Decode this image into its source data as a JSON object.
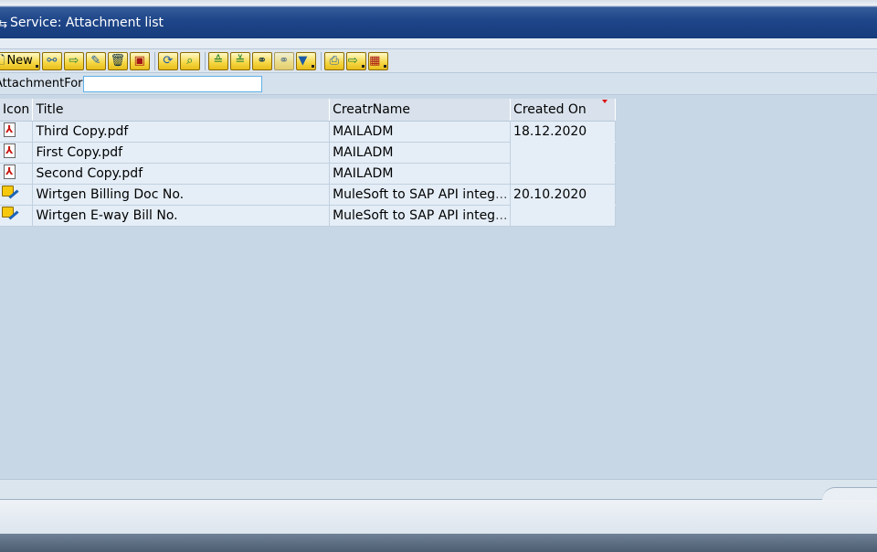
{
  "window": {
    "title": "Service: Attachment list",
    "title_icon": "service-icon"
  },
  "toolbar": {
    "new_label": "New",
    "buttons": [
      {
        "name": "new-button",
        "icon": "new-document-icon",
        "menu": true
      },
      {
        "name": "relationship-button",
        "icon": "relationship-icon",
        "menu": false
      },
      {
        "name": "export-button",
        "icon": "export-icon",
        "menu": false
      },
      {
        "name": "edit-button",
        "icon": "pencil-icon",
        "menu": false
      },
      {
        "name": "delete-button",
        "icon": "trash-icon",
        "menu": false
      },
      {
        "name": "display-button",
        "icon": "display-icon",
        "menu": false
      },
      {
        "name": "refresh-button",
        "icon": "refresh-icon",
        "menu": false
      },
      {
        "name": "detail-button",
        "icon": "magnifier-icon",
        "menu": false
      },
      {
        "name": "sort-ascending-button",
        "icon": "sort-ascending-icon",
        "menu": false
      },
      {
        "name": "sort-descending-button",
        "icon": "sort-descending-icon",
        "menu": false
      },
      {
        "name": "find-button",
        "icon": "binoculars-icon",
        "menu": false
      },
      {
        "name": "find-next-button",
        "icon": "find-next-icon",
        "menu": false
      },
      {
        "name": "filter-button",
        "icon": "filter-icon",
        "menu": true
      },
      {
        "name": "print-button",
        "icon": "printer-icon",
        "menu": false
      },
      {
        "name": "export-list-button",
        "icon": "export-list-icon",
        "menu": true
      },
      {
        "name": "layout-button",
        "icon": "layout-grid-icon",
        "menu": true
      }
    ]
  },
  "attachment_for": {
    "label": "AttachmentFor",
    "value": ""
  },
  "table": {
    "columns": [
      "Icon",
      "Title",
      "CreatrName",
      "Created On"
    ],
    "rows": [
      {
        "icon": "pdf-icon",
        "title": "Third Copy.pdf",
        "creator": "MAILADM",
        "created_on": "18.12.2020"
      },
      {
        "icon": "pdf-icon",
        "title": "First Copy.pdf",
        "creator": "MAILADM",
        "created_on": ""
      },
      {
        "icon": "pdf-icon",
        "title": "Second Copy.pdf",
        "creator": "MAILADM",
        "created_on": ""
      },
      {
        "icon": "note-icon",
        "title": "Wirtgen Billing Doc No.",
        "creator": "MuleSoft to SAP API integ",
        "created_on": "20.10.2020"
      },
      {
        "icon": "note-icon",
        "title": "Wirtgen E-way Bill No.",
        "creator": "MuleSoft to SAP API integ",
        "created_on": ""
      }
    ],
    "ellipsis": "..."
  },
  "colors": {
    "title_bar": "#1f4689",
    "client_bg": "#c8d7e5",
    "button_yellow": "#f5d642",
    "sort_marker": "#dd1111"
  }
}
